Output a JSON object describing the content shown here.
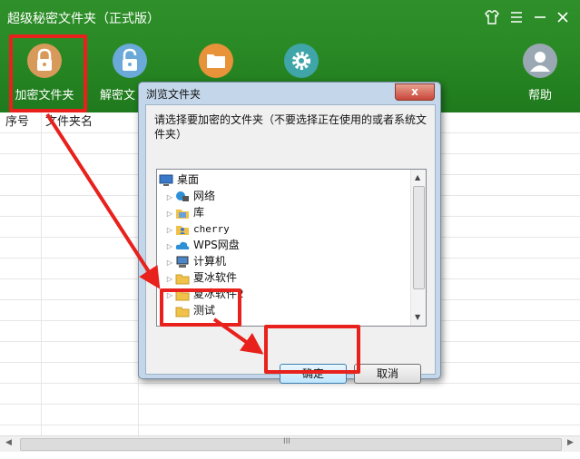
{
  "app": {
    "title": "超级秘密文件夹（正式版）",
    "window_controls": [
      "shirt-icon",
      "menu-icon",
      "minimize-icon",
      "close-icon"
    ]
  },
  "toolbar": {
    "encrypt_label": "加密文件夹",
    "decrypt_label": "解密文",
    "help_label": "帮助"
  },
  "table": {
    "columns": [
      "序号",
      "文件夹名"
    ]
  },
  "dialog": {
    "title": "浏览文件夹",
    "prompt": "请选择要加密的文件夹（不要选择正在使用的或者系统文件夹）",
    "tree": [
      {
        "label": "桌面",
        "icon": "desktop-icon",
        "expander": ""
      },
      {
        "label": "网络",
        "icon": "network-icon",
        "expander": "▷"
      },
      {
        "label": "库",
        "icon": "library-icon",
        "expander": "▷"
      },
      {
        "label": "cherry",
        "icon": "user-icon",
        "expander": "▷"
      },
      {
        "label": "WPS网盘",
        "icon": "cloud-icon",
        "expander": "▷"
      },
      {
        "label": "计算机",
        "icon": "computer-icon",
        "expander": "▷"
      },
      {
        "label": "夏冰软件",
        "icon": "folder-icon",
        "expander": "▷"
      },
      {
        "label": "夏冰软件2",
        "icon": "folder-icon",
        "expander": "▷"
      },
      {
        "label": "测试",
        "icon": "folder-icon",
        "expander": ""
      }
    ],
    "ok_label": "确定",
    "cancel_label": "取消",
    "close_glyph": "x"
  },
  "scrollbar": {
    "grip": "III"
  },
  "colors": {
    "header_green": "#2a8a25",
    "highlight_red": "#e8211c",
    "encrypt_icon": "#d89a5a",
    "decrypt_icon": "#6aa9d8",
    "folder_icon": "#e8923a",
    "settings_icon": "#3fa5a8",
    "help_icon": "#9aa8b4"
  }
}
